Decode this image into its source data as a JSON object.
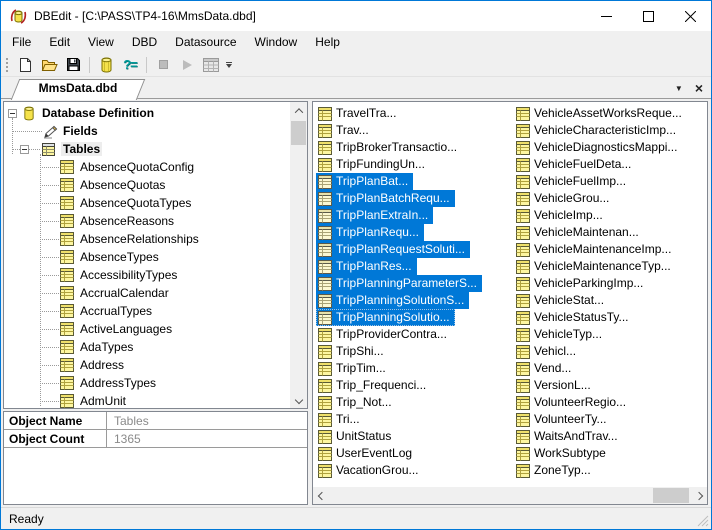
{
  "window": {
    "title": "DBEdit - [C:\\PASS\\TP4-16\\MmsData.dbd]"
  },
  "menu": {
    "items": [
      "File",
      "Edit",
      "View",
      "DBD",
      "Datasource",
      "Window",
      "Help"
    ]
  },
  "toolbar": {
    "buttons": [
      "new-document",
      "open-file",
      "save",
      "database",
      "help-database",
      "stop",
      "run",
      "table-view"
    ],
    "help_glyph": "?="
  },
  "tabs": {
    "active_label": "MmsData.dbd",
    "dropdown_glyph": "▼",
    "close_glyph": "×"
  },
  "tree": {
    "root_label": "Database Definition",
    "fields_label": "Fields",
    "tables_label": "Tables",
    "table_items": [
      "AbsenceQuotaConfig",
      "AbsenceQuotas",
      "AbsenceQuotaTypes",
      "AbsenceReasons",
      "AbsenceRelationships",
      "AbsenceTypes",
      "AccessibilityTypes",
      "AccrualCalendar",
      "AccrualTypes",
      "ActiveLanguages",
      "AdaTypes",
      "Address",
      "AddressTypes",
      "AdmUnit"
    ]
  },
  "properties": {
    "rows": [
      {
        "label": "Object Name",
        "value": "Tables"
      },
      {
        "label": "Object Count",
        "value": "1365"
      }
    ]
  },
  "list": {
    "columns": [
      {
        "items": [
          {
            "label": "TravelTra...",
            "selected": false
          },
          {
            "label": "Trav...",
            "selected": false
          },
          {
            "label": "TripBrokerTransactio...",
            "selected": false
          },
          {
            "label": "TripFundingUn...",
            "selected": false
          },
          {
            "label": "TripPlanBat...",
            "selected": true
          },
          {
            "label": "TripPlanBatchRequ...",
            "selected": true
          },
          {
            "label": "TripPlanExtraIn...",
            "selected": true
          },
          {
            "label": "TripPlanRequ...",
            "selected": true
          },
          {
            "label": "TripPlanRequestSoluti...",
            "selected": true
          },
          {
            "label": "TripPlanRes...",
            "selected": true
          },
          {
            "label": "TripPlanningParameterS...",
            "selected": true
          },
          {
            "label": "TripPlanningSolutionS...",
            "selected": true
          },
          {
            "label": "TripPlanningSolutio...",
            "selected": true,
            "focused": true
          },
          {
            "label": "TripProviderContra...",
            "selected": false
          },
          {
            "label": "TripShi...",
            "selected": false
          },
          {
            "label": "TripTim...",
            "selected": false
          },
          {
            "label": "Trip_Frequenci...",
            "selected": false
          },
          {
            "label": "Trip_Not...",
            "selected": false
          },
          {
            "label": "Tri...",
            "selected": false
          },
          {
            "label": "UnitStatus",
            "selected": false
          },
          {
            "label": "UserEventLog",
            "selected": false
          },
          {
            "label": "VacationGrou...",
            "selected": false
          }
        ]
      },
      {
        "items": [
          {
            "label": "VehicleAssetWorksReque...",
            "selected": false
          },
          {
            "label": "VehicleCharacteristicImp...",
            "selected": false
          },
          {
            "label": "VehicleDiagnosticsMappi...",
            "selected": false
          },
          {
            "label": "VehicleFuelDeta...",
            "selected": false
          },
          {
            "label": "VehicleFuelImp...",
            "selected": false
          },
          {
            "label": "VehicleGrou...",
            "selected": false
          },
          {
            "label": "VehicleImp...",
            "selected": false
          },
          {
            "label": "VehicleMaintenan...",
            "selected": false
          },
          {
            "label": "VehicleMaintenanceImp...",
            "selected": false
          },
          {
            "label": "VehicleMaintenanceTyp...",
            "selected": false
          },
          {
            "label": "VehicleParkingImp...",
            "selected": false
          },
          {
            "label": "VehicleStat...",
            "selected": false
          },
          {
            "label": "VehicleStatusTy...",
            "selected": false
          },
          {
            "label": "VehicleTyp...",
            "selected": false
          },
          {
            "label": "Vehicl...",
            "selected": false
          },
          {
            "label": "Vend...",
            "selected": false
          },
          {
            "label": "VersionL...",
            "selected": false
          },
          {
            "label": "VolunteerRegio...",
            "selected": false
          },
          {
            "label": "VolunteerTy...",
            "selected": false
          },
          {
            "label": "WaitsAndTrav...",
            "selected": false
          },
          {
            "label": "WorkSubtype",
            "selected": false
          },
          {
            "label": "ZoneTyp...",
            "selected": false
          }
        ]
      }
    ]
  },
  "statusbar": {
    "text": "Ready"
  },
  "colors": {
    "accent_border": "#0078d7",
    "selection_bg": "#0078d7",
    "selection_text": "#ffffff",
    "chrome_bg": "#f0f0f0",
    "panel_bg": "#ffffff",
    "value_text": "#8a8a8a"
  }
}
